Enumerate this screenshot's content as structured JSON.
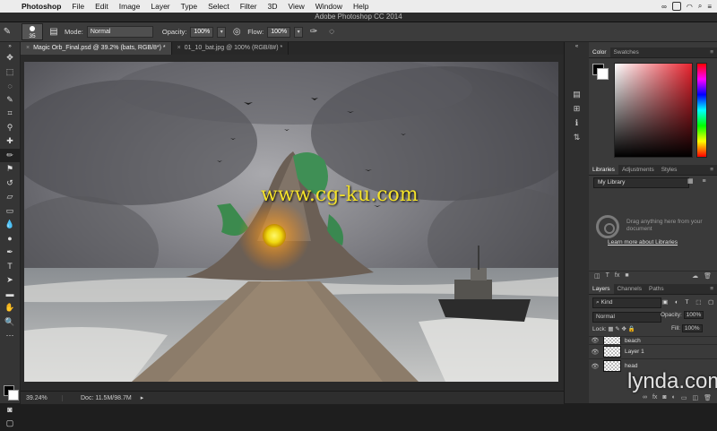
{
  "menubar": {
    "app": "Photoshop",
    "items": [
      "File",
      "Edit",
      "Image",
      "Layer",
      "Type",
      "Select",
      "Filter",
      "3D",
      "View",
      "Window",
      "Help"
    ]
  },
  "window_title": "Adobe Photoshop CC 2014",
  "options": {
    "brush_size": "35",
    "mode_label": "Mode:",
    "mode_value": "Normal",
    "opacity_label": "Opacity:",
    "opacity_value": "100%",
    "flow_label": "Flow:",
    "flow_value": "100%"
  },
  "doc_tabs": [
    {
      "title": "Magic Orb_Final.psd @ 39.2% (bats, RGB/8*) *"
    },
    {
      "title": "01_10_bat.jpg @ 100% (RGB/8#) *"
    }
  ],
  "status": {
    "zoom": "39.24%",
    "doc": "Doc: 11.5M/98.7M"
  },
  "color_panel": {
    "tabs": [
      "Color",
      "Swatches"
    ]
  },
  "libraries_panel": {
    "tabs": [
      "Libraries",
      "Adjustments",
      "Styles"
    ],
    "library_name": "My Library",
    "empty_text": "Drag anything here from your document",
    "link": "Learn more about Libraries"
  },
  "layers_panel": {
    "tabs": [
      "Layers",
      "Channels",
      "Paths"
    ],
    "kind": "Kind",
    "blend_mode": "Normal",
    "opacity_label": "Opacity:",
    "opacity_value": "100%",
    "lock_label": "Lock:",
    "fill_label": "Fill:",
    "fill_value": "100%",
    "layers": [
      {
        "name": "beach"
      },
      {
        "name": "Layer 1"
      },
      {
        "name": "head"
      }
    ]
  },
  "watermark": "www.cg-ku.com",
  "brand": "lynda.com",
  "colors": {
    "accent": "#f4e22a",
    "panel": "#3a3a3a"
  }
}
